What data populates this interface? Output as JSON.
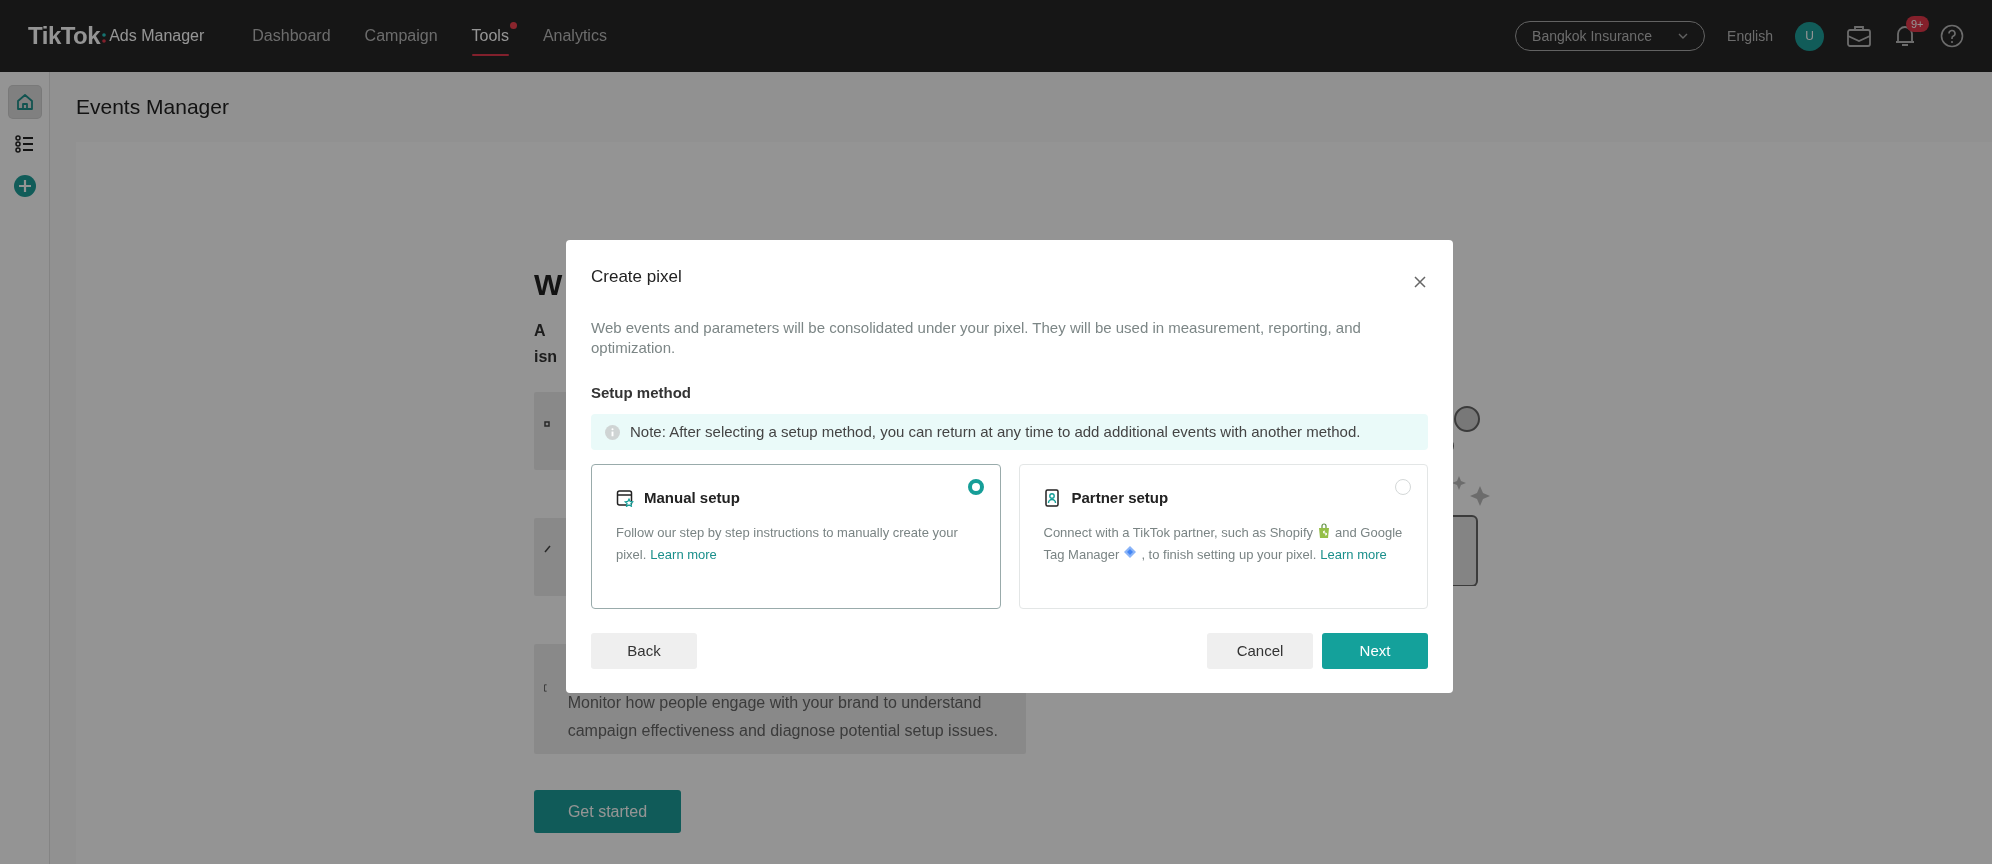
{
  "top_bar": {
    "logo": "TikTok",
    "product": "Ads Manager",
    "nav": [
      {
        "label": "Dashboard",
        "selected": false,
        "has_dot": false
      },
      {
        "label": "Campaign",
        "selected": false,
        "has_dot": false
      },
      {
        "label": "Tools",
        "selected": true,
        "has_dot": true
      },
      {
        "label": "Analytics",
        "selected": false,
        "has_dot": false
      }
    ],
    "account": "Bangkok Insurance",
    "language": "English",
    "avatar": "U",
    "notifications_badge": "9+"
  },
  "sidebar": {
    "items": [
      {
        "kind": "home",
        "selected": true
      },
      {
        "kind": "list",
        "selected": false
      },
      {
        "kind": "add",
        "selected": false
      }
    ]
  },
  "page_title": "Events Manager",
  "background": {
    "heading": "W",
    "intro_lines": [
      "A",
      "isn"
    ],
    "cards": [
      {
        "kind": "square"
      },
      {
        "kind": "slash"
      },
      {
        "kind": "bracket",
        "text": "Monitor how people engage with your brand to understand campaign effectiveness and diagnose potential setup issues."
      }
    ],
    "button": "Get started"
  },
  "modal": {
    "title": "Create pixel",
    "description": "Web events and parameters will be consolidated under your pixel. They will be used in measurement, reporting, and optimization.",
    "section_label": "Setup method",
    "note": "Note: After selecting a setup method, you can return at any time to add additional events with another method.",
    "options": [
      {
        "kind": "manual",
        "title": "Manual setup",
        "selected": true,
        "description": [
          {
            "kind": "text",
            "text": "Follow our step by step instructions to manually create your pixel."
          },
          {
            "kind": "link",
            "text": "Learn more"
          }
        ]
      },
      {
        "kind": "partner",
        "title": "Partner setup",
        "selected": false,
        "description": [
          {
            "kind": "text",
            "text": "Connect with a TikTok partner, such as Shopify"
          },
          {
            "kind": "bag"
          },
          {
            "kind": "text",
            "text": "and Google Tag Manager"
          },
          {
            "kind": "diamond"
          },
          {
            "kind": "text",
            "text": ", to finish setting up your pixel."
          },
          {
            "kind": "link",
            "text": "Learn more"
          }
        ]
      }
    ],
    "buttons": [
      {
        "label": "Back",
        "kind": "secondary"
      },
      {
        "label": "Cancel",
        "kind": "secondary"
      },
      {
        "label": "Next",
        "kind": "primary"
      }
    ]
  }
}
